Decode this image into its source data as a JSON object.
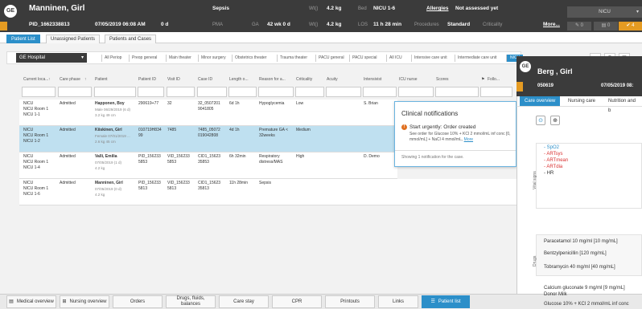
{
  "header": {
    "patient_name": "Manninen, Girl",
    "patient_id": "PID_1662338813",
    "birth": "07/05/2019 06:08 AM",
    "age": "0 d",
    "diagnosis": "Sepsis",
    "pma_label": "PMA",
    "ga_label": "GA",
    "ga_value": "42 wk 0 d",
    "wt_label1": "Wt()",
    "wt_value1": "4.2 kg",
    "wt_label2": "Wt()",
    "wt_value2": "4.2 kg",
    "bed_label": "Bed",
    "bed_value": "NICU 1-6",
    "los_label": "LOS",
    "los_value": "11 h 28 min",
    "allergies_label": "Allergies",
    "allergies_value": "Not assessed yet",
    "procedures_label": "Procedures",
    "procedures_value": "Standard",
    "criticality_label": "Criticality",
    "more_label": "More...",
    "ward": "NICU",
    "btn1": "0",
    "btn2": "0",
    "btn3": "4"
  },
  "tabs": [
    "Patient List",
    "Unassigned Patients",
    "Patients and Cases"
  ],
  "filters": {
    "hospital": "GE Hospital",
    "tabs": [
      "All Periop",
      "Preop general",
      "Main theater",
      "Minor surgery",
      "Obstetrics theater",
      "Trauma theater",
      "PACU general",
      "PACU special",
      "All ICU",
      "Intensive care unit",
      "Intermediate care unit",
      "NICU"
    ]
  },
  "columns": [
    "Current loca...",
    "Care phase",
    "Patient",
    "Patient ID",
    "Visit ID",
    "Case ID",
    "Length o...",
    "Reason for a...",
    "Criticality",
    "Acuity",
    "Intensivist",
    "ICU nurse",
    "Scores",
    "Follo..."
  ],
  "rows": [
    {
      "loc": [
        "NICU",
        "NICU Room 1",
        "NICU 1-1"
      ],
      "phase": "Admitted",
      "name": "Happonen, Boy",
      "sub1": "Male 06/29/2019 (6 d)",
      "sub2": "3.2 kg 49 cm",
      "pid": "290619+77",
      "vid": "32",
      "cid": [
        "32_0507201",
        "9041805"
      ],
      "los": "6d 1h",
      "reason": [
        "Hypoglycemia"
      ],
      "crit": "Low",
      "intensivist": "S. Brian"
    },
    {
      "loc": [
        "NICU",
        "NICU Room 1",
        "NICU 1-2"
      ],
      "phase": "Admitted",
      "name": "Kiiskinen, Girl",
      "sub1": "Female 07/01/2019 ...",
      "sub2": "2.6 kg 45 cm",
      "pid": "010719H834",
      "pid2": "99",
      "vid": "7485",
      "cid": [
        "7485_05072",
        "019042808"
      ],
      "los": "4d 1h",
      "reason": [
        "Premature GA <",
        "32weeks"
      ],
      "crit": "Medium",
      "intensivist": ""
    },
    {
      "loc": [
        "NICU",
        "NICU Room 1",
        "NICU 1-4"
      ],
      "phase": "Admitted",
      "name": "Valli, Emilia",
      "sub1": "07/05/2019 (1 d)",
      "sub2": "4.2 kg",
      "pid": "PID_156233",
      "pid2": "5853",
      "vid": "VID_156233",
      "vid2": "5853",
      "cid": [
        "CID1_15623",
        "35853"
      ],
      "los": "6h 32min",
      "reason": [
        "Respiratory",
        "distress/MAS"
      ],
      "crit": "High",
      "intensivist": "D. Demo"
    },
    {
      "loc": [
        "NICU",
        "NICU Room 1",
        "NICU 1-6"
      ],
      "phase": "Admitted",
      "name": "Manninen, Girl",
      "sub1": "07/05/2019 (0 d)",
      "sub2": "4.2 kg",
      "pid": "PID_156233",
      "pid2": "5813",
      "vid": "VID_156233",
      "vid2": "5813",
      "cid": [
        "CID1_15623",
        "35813"
      ],
      "los": "11h 28min",
      "reason": [
        "Sepsis"
      ],
      "crit": "",
      "intensivist": ""
    }
  ],
  "notification": {
    "title": "Clinical notifications",
    "item_title": "Start urgently: Order created",
    "item_text1": "See order for Glucose 10% + KCl 2 mmol/mL inf conc [0,",
    "item_text2": "mmol/mL] + NaCl 4 mmol/mL,",
    "more": "More",
    "footer": "Showing 1 notification for the case."
  },
  "right_panel": {
    "name": "Berg , Girl",
    "id": "050619",
    "date": "07/05/2019 08:",
    "tabs": [
      "Care overview",
      "Nursing care",
      "Nutrition and b"
    ],
    "vitals_label": "Vital signs",
    "vitals": [
      {
        "label": "- SpO2",
        "color": "#2c8fc9"
      },
      {
        "label": "- ARTsys",
        "color": "#d93030"
      },
      {
        "label": "- ARTmean",
        "color": "#d93030"
      },
      {
        "label": "- ARTdia",
        "color": "#d93030"
      },
      {
        "label": "- HR",
        "color": "#333333"
      }
    ],
    "drugs_label": "Drugs",
    "drugs": [
      "Paracetamol 10 mg/ml [10 mg/mL]",
      "Bentzylpenicillin [120 mg/mL]",
      "Tobramycin 40 mg/ml [40 mg/mL]"
    ],
    "fluids": [
      "Calcium gluconate 9 mg/ml [9 mg/mL]",
      "Donor Milk",
      "Glucose 10% + KCl 2 mmol/mL inf conc"
    ]
  },
  "bottom_nav": [
    "Medical overview",
    "Nursing overview",
    "Orders",
    "Drugs, fluids, balances",
    "Care stay",
    "CPR",
    "Printouts",
    "Links",
    "Patient list"
  ]
}
